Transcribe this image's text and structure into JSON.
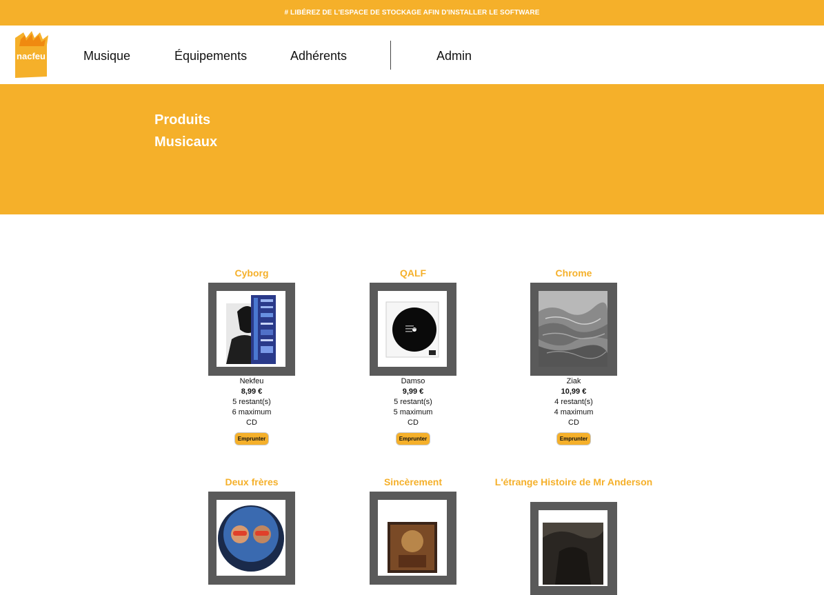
{
  "banner": {
    "text": "# LIBÉREZ DE L'ESPACE DE STOCKAGE AFIN D'INSTALLER LE SOFTWARE"
  },
  "logo": {
    "text": "nacfeu"
  },
  "nav": {
    "items": [
      "Musique",
      "Équipements",
      "Adhérents"
    ],
    "admin": "Admin"
  },
  "hero": {
    "line1": "Produits",
    "line2": "Musicaux"
  },
  "products": [
    {
      "title": "Cyborg",
      "artist": "Nekfeu",
      "price": "8,99 €",
      "remaining": "5 restant(s)",
      "maximum": "6 maximum",
      "format": "CD",
      "button": "Emprunter"
    },
    {
      "title": "QALF",
      "artist": "Damso",
      "price": "9,99 €",
      "remaining": "5 restant(s)",
      "maximum": "5 maximum",
      "format": "CD",
      "button": "Emprunter"
    },
    {
      "title": "Chrome",
      "artist": "Ziak",
      "price": "10,99 €",
      "remaining": "4 restant(s)",
      "maximum": "4 maximum",
      "format": "CD",
      "button": "Emprunter"
    },
    {
      "title": "Deux frères"
    },
    {
      "title": "Sincèrement"
    },
    {
      "title": "L'étrange Histoire de Mr Anderson"
    }
  ],
  "colors": {
    "accent": "#f5b02a",
    "frame": "#5a5a5a"
  }
}
